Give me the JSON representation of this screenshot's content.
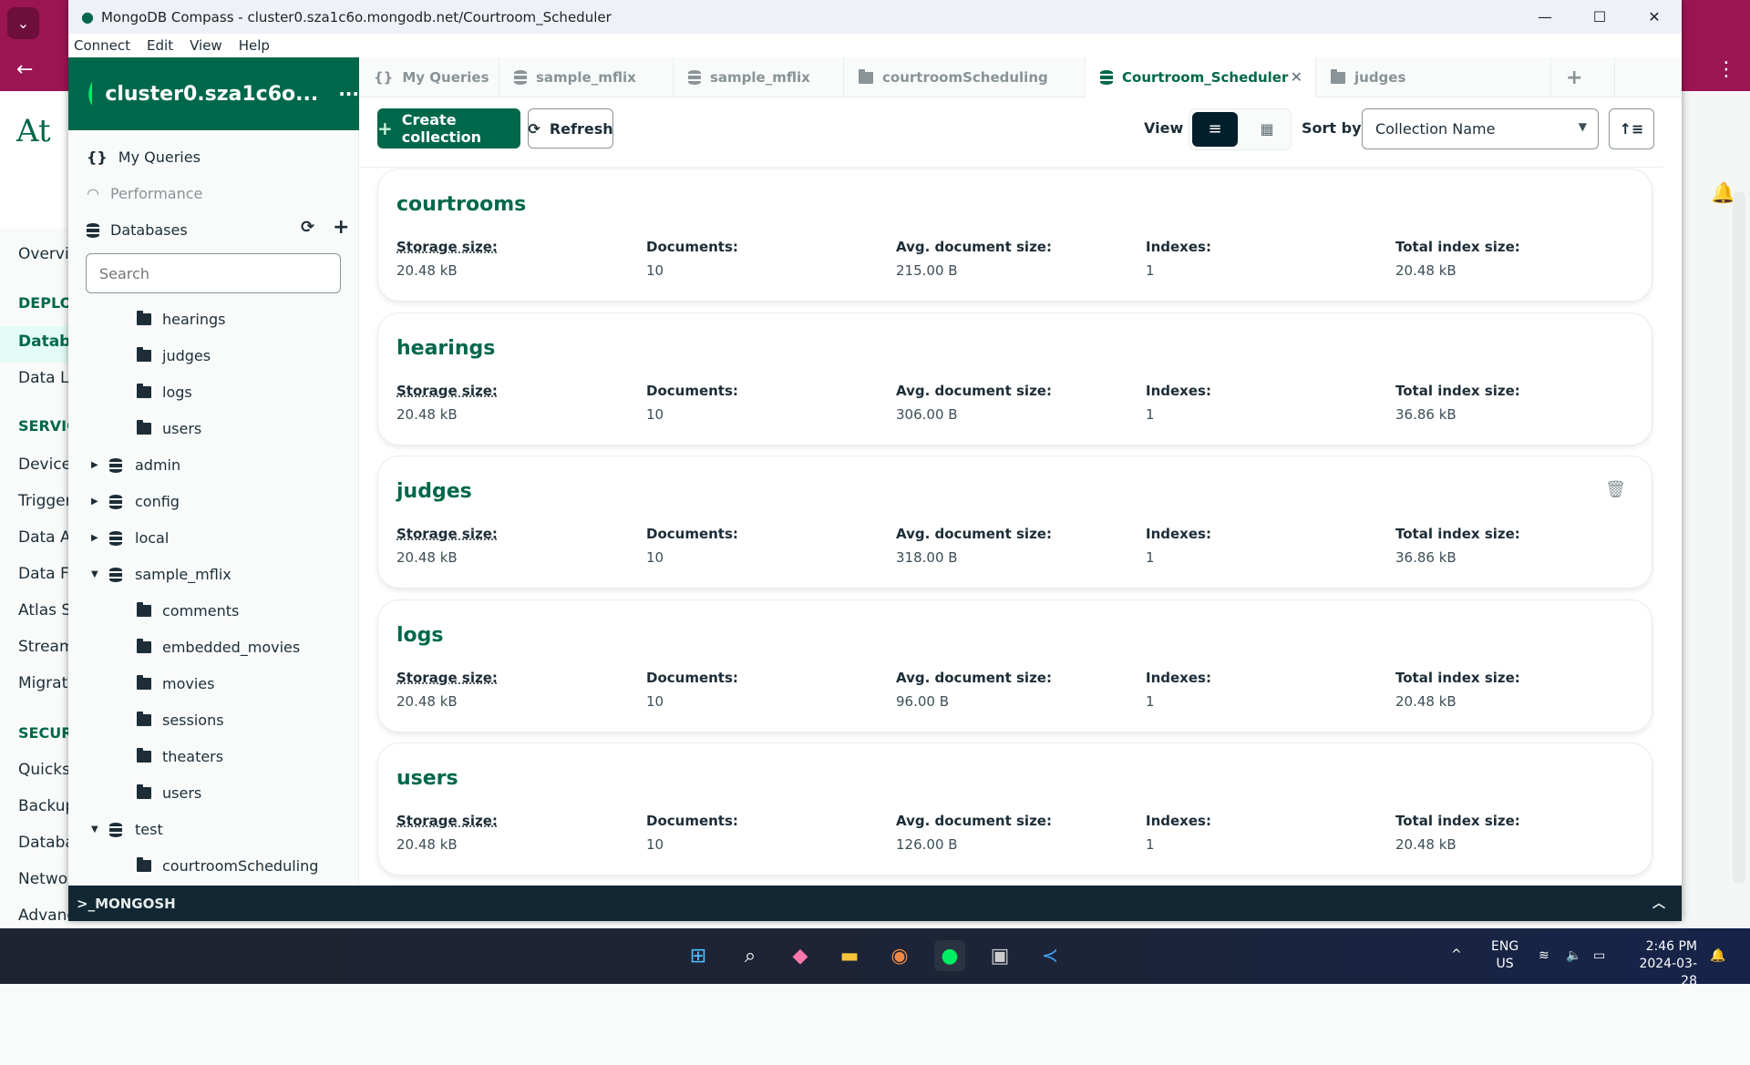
{
  "background": {
    "left_nav": [
      "Overview",
      "Database",
      "Data Lake",
      "Device",
      "Triggers",
      "Data API",
      "Data Federation",
      "Atlas Search",
      "Stream",
      "Migration",
      "Quickstart",
      "Backup",
      "Database",
      "Network",
      "Advanced"
    ],
    "sections": [
      "DEPLOYMENT",
      "SERVICES",
      "SECURITY"
    ],
    "logo_text": "At"
  },
  "window": {
    "title": "MongoDB Compass - cluster0.sza1c6o.mongodb.net/Courtroom_Scheduler",
    "menu": [
      "Connect",
      "Edit",
      "View",
      "Help"
    ]
  },
  "sidebar": {
    "connection_name": "cluster0.sza1c6o...",
    "my_queries": "My Queries",
    "performance": "Performance",
    "databases": "Databases",
    "search_placeholder": "Search",
    "tree": [
      {
        "type": "collection",
        "label": "hearings"
      },
      {
        "type": "collection",
        "label": "judges"
      },
      {
        "type": "collection",
        "label": "logs"
      },
      {
        "type": "collection",
        "label": "users"
      },
      {
        "type": "database",
        "label": "admin",
        "expanded": false
      },
      {
        "type": "database",
        "label": "config",
        "expanded": false
      },
      {
        "type": "database",
        "label": "local",
        "expanded": false
      },
      {
        "type": "database",
        "label": "sample_mflix",
        "expanded": true
      },
      {
        "type": "collection",
        "label": "comments"
      },
      {
        "type": "collection",
        "label": "embedded_movies"
      },
      {
        "type": "collection",
        "label": "movies"
      },
      {
        "type": "collection",
        "label": "sessions"
      },
      {
        "type": "collection",
        "label": "theaters"
      },
      {
        "type": "collection",
        "label": "users"
      },
      {
        "type": "database",
        "label": "test",
        "expanded": true
      },
      {
        "type": "collection",
        "label": "courtroomScheduling"
      }
    ]
  },
  "tabs": [
    {
      "label": "My Queries",
      "icon": "braces-icon"
    },
    {
      "label": "sample_mflix",
      "icon": "database-icon"
    },
    {
      "label": "sample_mflix",
      "icon": "database-icon"
    },
    {
      "label": "courtroomScheduling",
      "icon": "folder-icon"
    },
    {
      "label": "Courtroom_Scheduler",
      "icon": "database-icon",
      "active": true
    },
    {
      "label": "judges",
      "icon": "folder-icon"
    }
  ],
  "toolbar": {
    "create": "Create collection",
    "refresh": "Refresh",
    "view_label": "View",
    "view_mode": "list",
    "sort_label": "Sort by",
    "sort_value": "Collection Name"
  },
  "stat_labels": [
    "Storage size:",
    "Documents:",
    "Avg. document size:",
    "Indexes:",
    "Total index size:"
  ],
  "collections": [
    {
      "name": "courtrooms",
      "values": [
        "20.48 kB",
        "10",
        "215.00 B",
        "1",
        "20.48 kB"
      ]
    },
    {
      "name": "hearings",
      "values": [
        "20.48 kB",
        "10",
        "306.00 B",
        "1",
        "36.86 kB"
      ]
    },
    {
      "name": "judges",
      "values": [
        "20.48 kB",
        "10",
        "318.00 B",
        "1",
        "36.86 kB"
      ],
      "hovered": true
    },
    {
      "name": "logs",
      "values": [
        "20.48 kB",
        "10",
        "96.00 B",
        "1",
        "20.48 kB"
      ]
    },
    {
      "name": "users",
      "values": [
        "20.48 kB",
        "10",
        "126.00 B",
        "1",
        "20.48 kB"
      ]
    }
  ],
  "mongosh": ">_MONGOSH",
  "taskbar": {
    "lang": "ENG",
    "region": "US",
    "time": "2:46 PM",
    "date": "2024-03-28"
  },
  "colors": {
    "brand_green": "#00684a",
    "leaf_green": "#00ed64",
    "dark": "#001e2b",
    "browser_bar": "#9b1553"
  }
}
